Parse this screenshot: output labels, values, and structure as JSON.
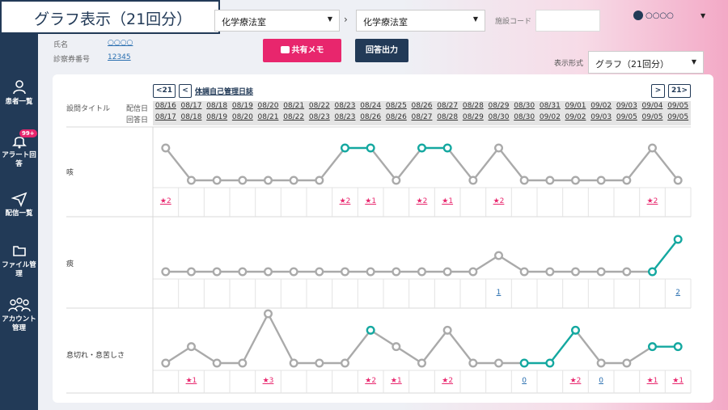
{
  "title": "グラフ表示（21回分）",
  "header": {
    "select1": "化学療法室",
    "select2": "化学療法室",
    "facility_label": "施設コード",
    "facility_value": "",
    "user_name": "○○○○"
  },
  "patient": {
    "name_label": "氏名",
    "name_value": "○○○○",
    "card_label": "診察券番号",
    "card_value": "12345"
  },
  "buttons": {
    "memo": "共有メモ",
    "answer_output": "回答出力"
  },
  "display": {
    "label": "表示形式",
    "value": "グラフ（21回分）"
  },
  "sidebar": [
    {
      "label": "患者一覧",
      "icon": "patient-icon"
    },
    {
      "label": "アラート回答",
      "icon": "bell-icon",
      "badge": "99+"
    },
    {
      "label": "配信一覧",
      "icon": "send-icon"
    },
    {
      "label": "ファイル管理",
      "icon": "folder-icon"
    },
    {
      "label": "アカウント管理",
      "icon": "users-icon"
    }
  ],
  "nav": {
    "prev": "<21",
    "prev_one": "<",
    "diary": "体調自己管理日誌",
    "next_one": ">",
    "next": "21>"
  },
  "table_headers": {
    "question_title": "設問タイトル",
    "sent_date": "配信日",
    "answer_date": "回答日"
  },
  "sent_dates": [
    "08/16",
    "08/17",
    "08/18",
    "08/19",
    "08/20",
    "08/21",
    "08/22",
    "08/23",
    "08/24",
    "08/25",
    "08/26",
    "08/27",
    "08/28",
    "08/29",
    "08/30",
    "08/31",
    "09/01",
    "09/02",
    "09/03",
    "09/04",
    "09/05"
  ],
  "answer_dates": [
    "08/17",
    "08/18",
    "08/19",
    "08/20",
    "08/21",
    "08/22",
    "08/23",
    "08/23",
    "08/26",
    "08/26",
    "08/27",
    "08/28",
    "08/29",
    "08/30",
    "08/30",
    "09/02",
    "09/02",
    "09/03",
    "09/05",
    "09/05",
    "09/05"
  ],
  "colors": {
    "accent": "#e8266d",
    "navy": "#223a57",
    "teal": "#14a8a0",
    "gray": "#aaaaaa",
    "link": "#2a6fb0"
  },
  "chart_data": {
    "type": "line",
    "categories": [
      "08/16",
      "08/17",
      "08/18",
      "08/19",
      "08/20",
      "08/21",
      "08/22",
      "08/23",
      "08/24",
      "08/25",
      "08/26",
      "08/27",
      "08/28",
      "08/29",
      "08/30",
      "08/31",
      "09/01",
      "09/02",
      "09/03",
      "09/04",
      "09/05"
    ],
    "series": [
      {
        "name": "咳",
        "values": [
          2,
          1,
          1,
          1,
          1,
          1,
          1,
          2,
          2,
          1,
          2,
          2,
          1,
          2,
          1,
          1,
          1,
          1,
          1,
          2,
          1
        ],
        "ymin": 1,
        "ymax": 2,
        "labels": [
          "★2",
          "",
          "",
          "",
          "",
          "",
          "",
          "★2",
          "★1",
          "",
          "★2",
          "★1",
          "",
          "★2",
          "",
          "",
          "",
          "",
          "",
          "★2",
          ""
        ],
        "alerts": [
          0,
          0,
          0,
          0,
          0,
          0,
          0,
          1,
          1,
          0,
          1,
          1,
          0,
          0,
          0,
          0,
          0,
          0,
          0,
          0,
          0
        ]
      },
      {
        "name": "痰",
        "values": [
          0,
          0,
          0,
          0,
          0,
          0,
          0,
          0,
          0,
          0,
          0,
          0,
          0,
          1,
          0,
          0,
          0,
          0,
          0,
          0,
          2
        ],
        "ymin": 0,
        "ymax": 2,
        "labels": [
          "",
          "",
          "",
          "",
          "",
          "",
          "",
          "",
          "",
          "",
          "",
          "",
          "",
          "1",
          "",
          "",
          "",
          "",
          "",
          "",
          "2"
        ],
        "alerts": [
          0,
          0,
          0,
          0,
          0,
          0,
          0,
          0,
          0,
          0,
          0,
          0,
          0,
          0,
          0,
          0,
          0,
          0,
          0,
          1,
          1
        ]
      },
      {
        "name": "息切れ・息苦しさ",
        "values": [
          0,
          1,
          0,
          0,
          3,
          0,
          0,
          0,
          2,
          1,
          0,
          2,
          0,
          0,
          0,
          0,
          2,
          0,
          0,
          1,
          1
        ],
        "ymin": 0,
        "ymax": 3,
        "labels": [
          "",
          "★1",
          "",
          "",
          "★3",
          "",
          "",
          "",
          "★2",
          "★1",
          "",
          "★2",
          "",
          "",
          "0",
          "",
          "★2",
          "0",
          "",
          "★1",
          "★1"
        ],
        "alerts": [
          0,
          0,
          0,
          0,
          0,
          0,
          0,
          0,
          1,
          0,
          0,
          0,
          0,
          0,
          1,
          1,
          1,
          0,
          0,
          1,
          1
        ]
      }
    ]
  }
}
